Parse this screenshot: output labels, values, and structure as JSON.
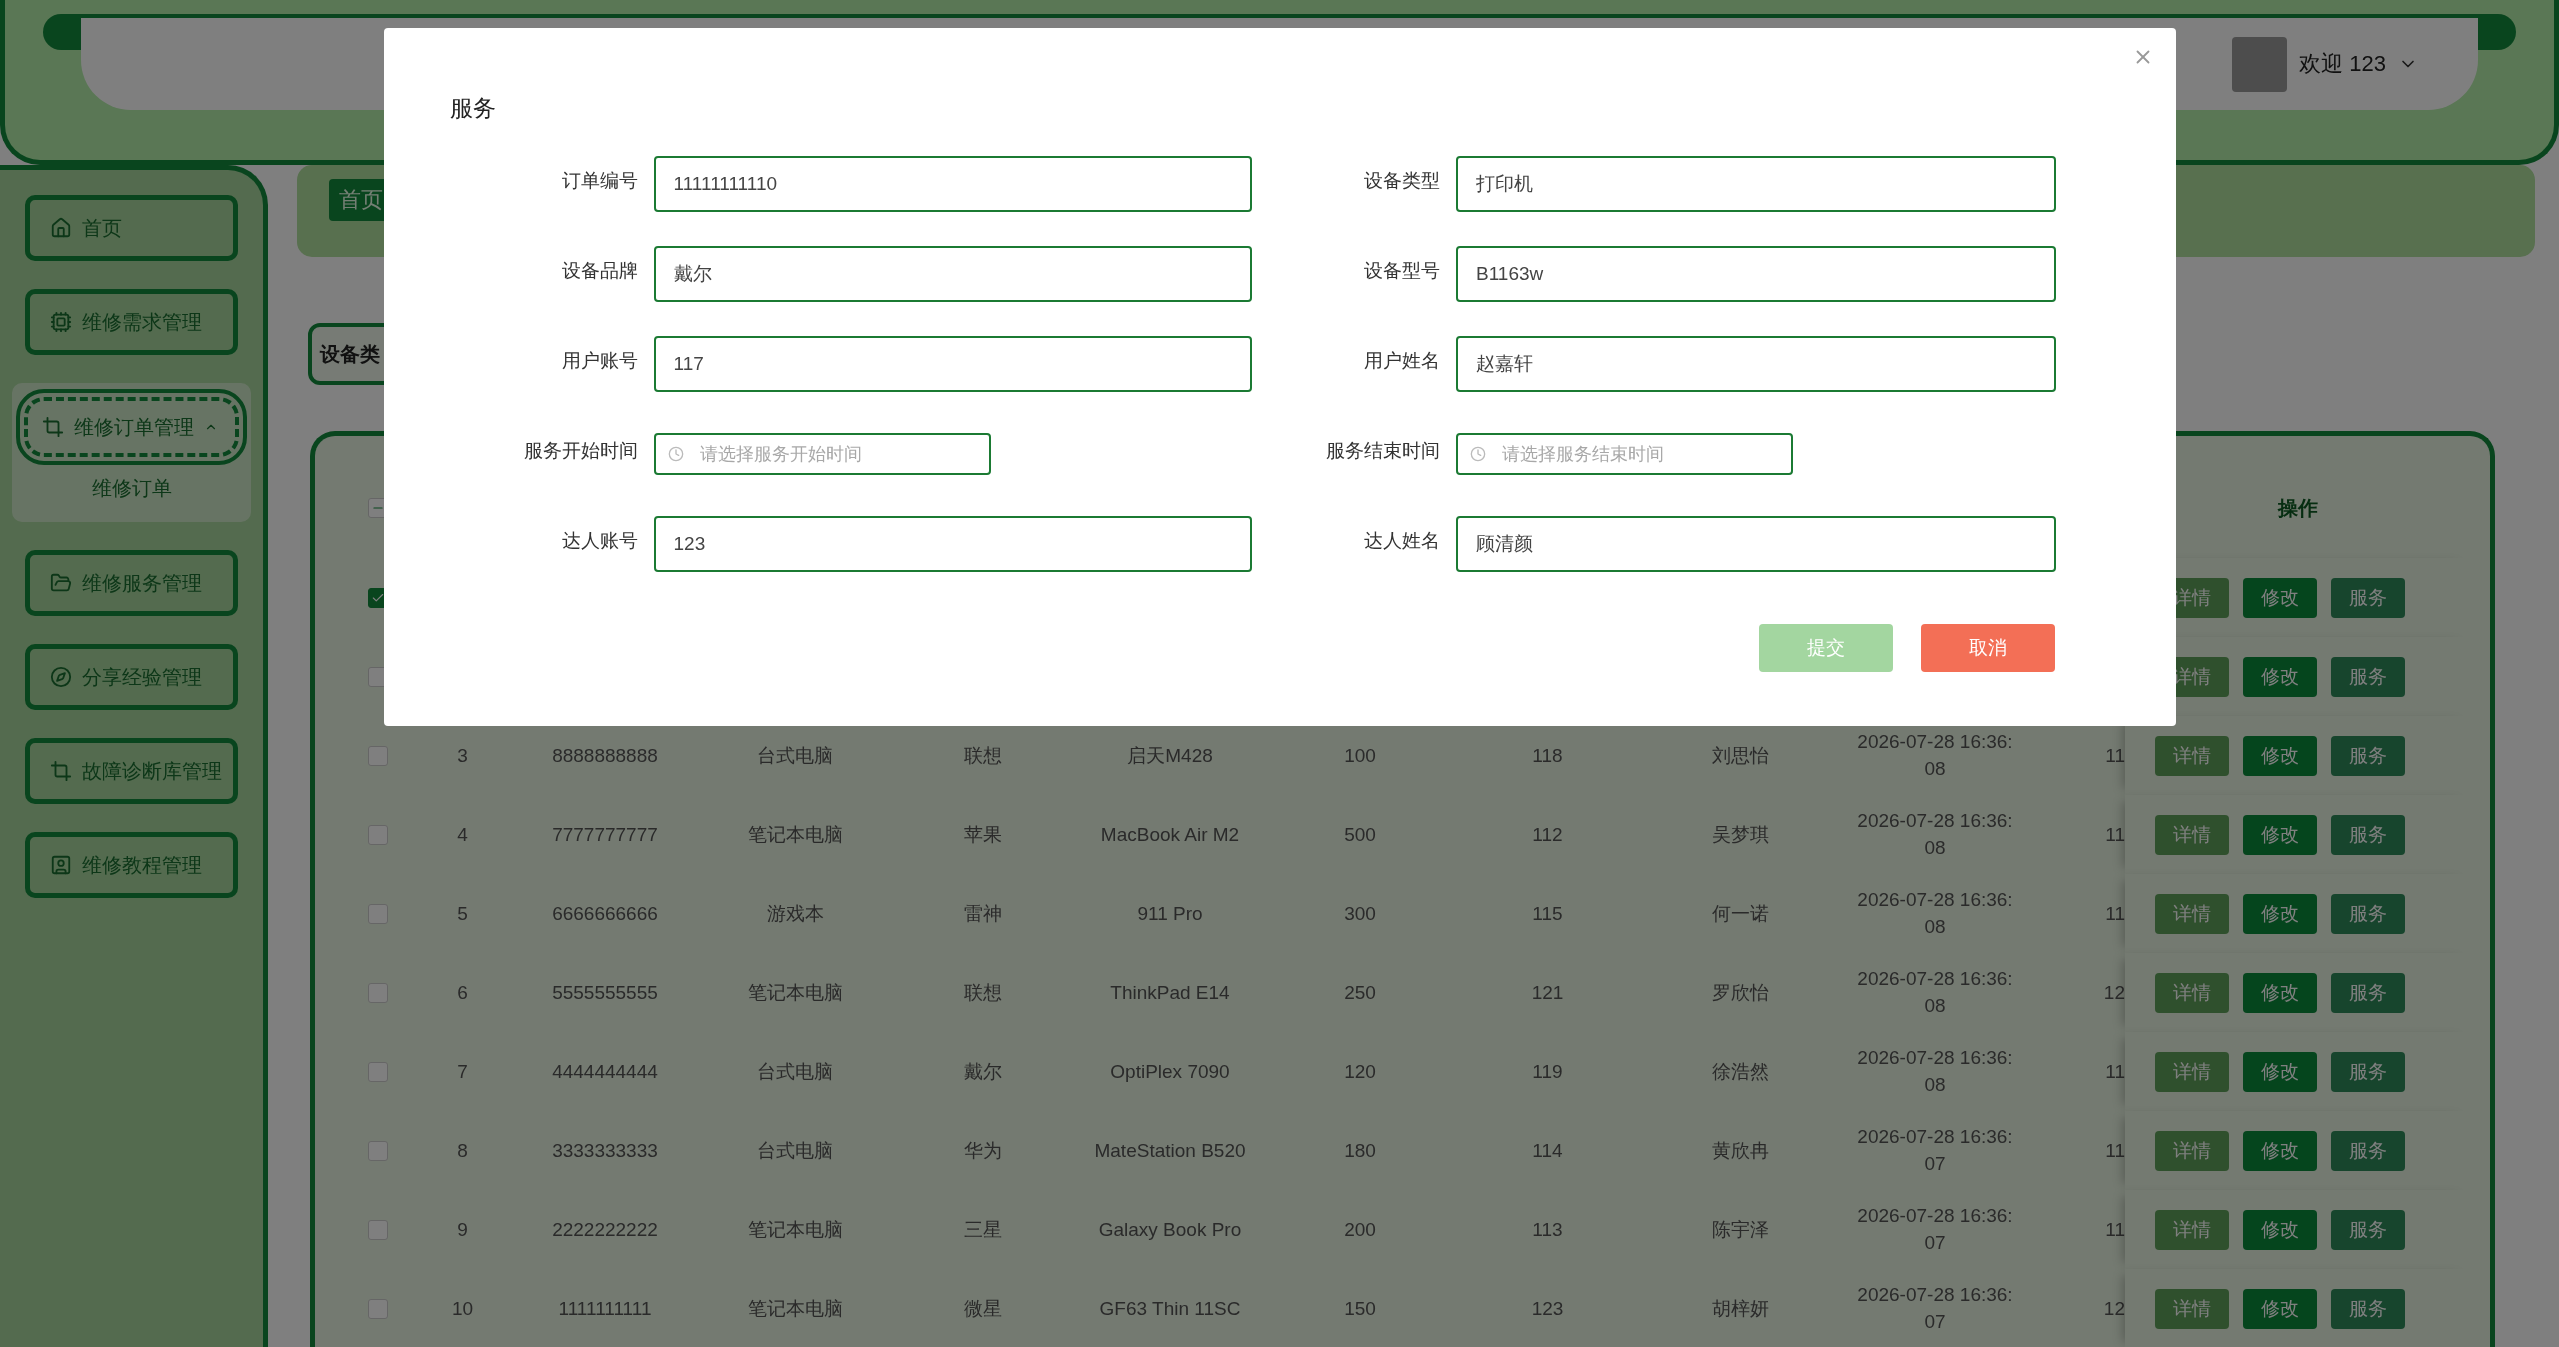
{
  "header": {
    "greeting": "欢迎 123"
  },
  "sidebar": {
    "items": [
      {
        "label": "首页",
        "selected": false
      },
      {
        "label": "维修需求管理",
        "selected": false
      },
      {
        "label": "维修订单管理",
        "selected": true,
        "expanded": true,
        "children": [
          {
            "label": "维修订单",
            "selected": false
          }
        ]
      },
      {
        "label": "维修服务管理",
        "selected": false
      },
      {
        "label": "分享经验管理",
        "selected": false
      },
      {
        "label": "故障诊断库管理",
        "selected": false
      },
      {
        "label": "维修教程管理",
        "selected": false
      }
    ]
  },
  "breadcrumb": {
    "tag": "首页"
  },
  "search": {
    "label": "设备类"
  },
  "table": {
    "header_checkbox": {
      "checked": false,
      "partial": true
    },
    "action_header": "操作",
    "rows": [
      {
        "checked": true,
        "actions": [
          "详情",
          "修改",
          "服务"
        ]
      },
      {
        "checked": false,
        "actions": [
          "详情",
          "修改",
          "服务"
        ]
      },
      {
        "checked": false,
        "cells": [
          "3",
          "8888888888",
          "台式电脑",
          "联想",
          "启天M428",
          "100",
          "118",
          "刘思怡",
          "2026-07-28 16:36:08",
          "11"
        ],
        "actions": [
          "详情",
          "修改",
          "服务"
        ]
      },
      {
        "checked": false,
        "cells": [
          "4",
          "7777777777",
          "笔记本电脑",
          "苹果",
          "MacBook Air M2",
          "500",
          "112",
          "吴梦琪",
          "2026-07-28 16:36:08",
          "11"
        ],
        "actions": [
          "详情",
          "修改",
          "服务"
        ]
      },
      {
        "checked": false,
        "cells": [
          "5",
          "6666666666",
          "游戏本",
          "雷神",
          "911 Pro",
          "300",
          "115",
          "何一诺",
          "2026-07-28 16:36:08",
          "11"
        ],
        "actions": [
          "详情",
          "修改",
          "服务"
        ]
      },
      {
        "checked": false,
        "cells": [
          "6",
          "5555555555",
          "笔记本电脑",
          "联想",
          "ThinkPad E14",
          "250",
          "121",
          "罗欣怡",
          "2026-07-28 16:36:08",
          "12"
        ],
        "actions": [
          "详情",
          "修改",
          "服务"
        ]
      },
      {
        "checked": false,
        "cells": [
          "7",
          "4444444444",
          "台式电脑",
          "戴尔",
          "OptiPlex 7090",
          "120",
          "119",
          "徐浩然",
          "2026-07-28 16:36:08",
          "11"
        ],
        "actions": [
          "详情",
          "修改",
          "服务"
        ]
      },
      {
        "checked": false,
        "cells": [
          "8",
          "3333333333",
          "台式电脑",
          "华为",
          "MateStation B520",
          "180",
          "114",
          "黄欣冉",
          "2026-07-28 16:36:07",
          "11"
        ],
        "actions": [
          "详情",
          "修改",
          "服务"
        ]
      },
      {
        "checked": false,
        "cells": [
          "9",
          "2222222222",
          "笔记本电脑",
          "三星",
          "Galaxy Book Pro",
          "200",
          "113",
          "陈宇泽",
          "2026-07-28 16:36:07",
          "11"
        ],
        "actions": [
          "详情",
          "修改",
          "服务"
        ]
      },
      {
        "checked": false,
        "cells": [
          "10",
          "1111111111",
          "笔记本电脑",
          "微星",
          "GF63 Thin 11SC",
          "150",
          "123",
          "胡梓妍",
          "2026-07-28 16:36:07",
          "12"
        ],
        "actions": [
          "详情",
          "修改",
          "服务"
        ]
      }
    ]
  },
  "dialog": {
    "title": "服务",
    "fields": [
      {
        "kind": "text",
        "label": "订单编号",
        "value": "11111111110"
      },
      {
        "kind": "text",
        "label": "设备类型",
        "value": "打印机"
      },
      {
        "kind": "text",
        "label": "设备品牌",
        "value": "戴尔"
      },
      {
        "kind": "text",
        "label": "设备型号",
        "value": "B1163w"
      },
      {
        "kind": "text",
        "label": "用户账号",
        "value": "117"
      },
      {
        "kind": "text",
        "label": "用户姓名",
        "value": "赵嘉轩"
      },
      {
        "kind": "datetime",
        "label": "服务开始时间",
        "placeholder": "请选择服务开始时间"
      },
      {
        "kind": "datetime",
        "label": "服务结束时间",
        "placeholder": "请选择服务结束时间"
      },
      {
        "kind": "text",
        "label": "达人账号",
        "value": "123"
      },
      {
        "kind": "text",
        "label": "达人姓名",
        "value": "顾清颜"
      }
    ],
    "buttons": [
      {
        "kind": "primary",
        "label": "提交"
      },
      {
        "kind": "danger",
        "label": "取消"
      }
    ]
  }
}
